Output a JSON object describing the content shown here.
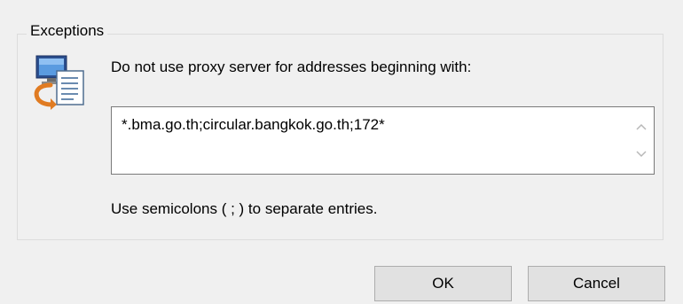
{
  "exceptions": {
    "legend": "Exceptions",
    "icon": "proxy-exception-icon",
    "description": "Do not use proxy server for addresses beginning with:",
    "value": "*.bma.go.th;circular.bangkok.go.th;172*",
    "hint": "Use semicolons ( ; ) to separate entries."
  },
  "buttons": {
    "ok_label": "OK",
    "cancel_label": "Cancel"
  },
  "colors": {
    "dialog_background": "#f0f0f0",
    "button_background": "#e1e1e1",
    "textbox_border": "#7a7a7a"
  }
}
